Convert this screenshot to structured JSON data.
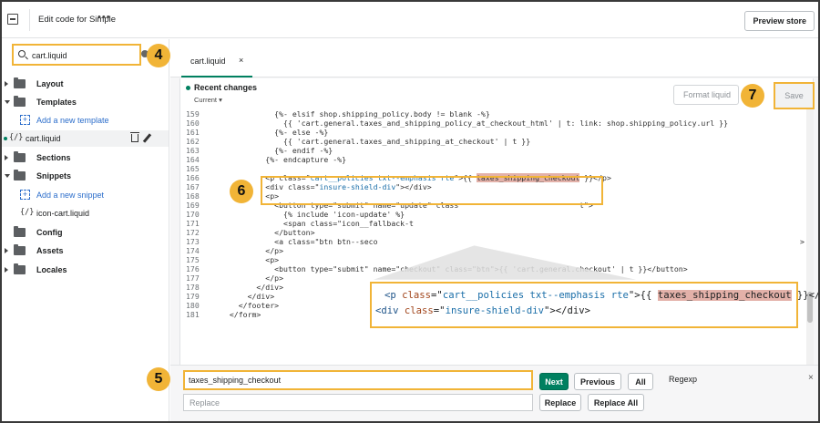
{
  "topbar": {
    "title": "Edit code for Simple",
    "more": "•••",
    "preview_label": "Preview store"
  },
  "sidebar": {
    "search_value": "cart.liquid",
    "items": [
      {
        "label": "Layout"
      },
      {
        "label": "Templates"
      },
      {
        "label": "Add a new template"
      },
      {
        "label": "cart.liquid"
      },
      {
        "label": "Sections"
      },
      {
        "label": "Snippets"
      },
      {
        "label": "Add a new snippet"
      },
      {
        "label": "icon-cart.liquid"
      },
      {
        "label": "Config"
      },
      {
        "label": "Assets"
      },
      {
        "label": "Locales"
      }
    ],
    "liquid_glyph": "{/}",
    "add_glyph": "+"
  },
  "badges": {
    "b4": "4",
    "b5": "5",
    "b6": "6",
    "b7": "7"
  },
  "editor": {
    "tab_label": "cart.liquid",
    "tab_close": "×",
    "recent_changes": "Recent changes",
    "current": "Current ▾",
    "format_label": "Format liquid",
    "save_label": "Save"
  },
  "code": {
    "lines": [
      {
        "n": "159",
        "t": "            {%- elsif shop.shipping_policy.body != blank -%}"
      },
      {
        "n": "160",
        "t": "              {{ 'cart.general.taxes_and_shipping_policy_at_checkout_html' | t: link: shop.shipping_policy.url }}"
      },
      {
        "n": "161",
        "t": "            {%- else -%}"
      },
      {
        "n": "162",
        "t": "              {{ 'cart.general.taxes_and_shipping_at_checkout' | t }}"
      },
      {
        "n": "163",
        "t": "            {%- endif -%}"
      },
      {
        "n": "164",
        "t": "          {%- endcapture -%}"
      },
      {
        "n": "165",
        "t": ""
      },
      {
        "n": "166",
        "t": ""
      },
      {
        "n": "167",
        "t": ""
      },
      {
        "n": "168",
        "t": "          <p>"
      },
      {
        "n": "169",
        "t": "            <button type=\"submit\" name=\"update\" class"
      },
      {
        "n": "170",
        "t": "              {% include 'icon-update' %}"
      },
      {
        "n": "171",
        "t": "              <span class=\"icon__fallback-t"
      },
      {
        "n": "172",
        "t": "            </button>"
      },
      {
        "n": "173",
        "t": "            <a class=\"btn btn--seco"
      },
      {
        "n": "174",
        "t": "          </p>"
      },
      {
        "n": "175",
        "t": "          <p>"
      },
      {
        "n": "176",
        "t": "            <button type=\"submit\" name=\"checkout\" class=\"btn\">{{ 'cart.general.checkout' | t }}</button>"
      },
      {
        "n": "177",
        "t": "          </p>"
      },
      {
        "n": "178",
        "t": "        </div>"
      },
      {
        "n": "179",
        "t": "      </div>"
      },
      {
        "n": "180",
        "t": "    </footer>"
      },
      {
        "n": "181",
        "t": "  </form>"
      }
    ],
    "line166": {
      "a": "          <p class=\"",
      "b": "cart__policies txt--emphasis rte",
      "c": "\">{{ ",
      "match": "taxes_shipping_checkout",
      "d": " }}</p>"
    },
    "line167": {
      "a": "          <div class=\"",
      "b": "insure-shield-div",
      "c": "\"></div>"
    },
    "tail169": "t\">",
    "tail173": ">"
  },
  "find": {
    "value": "taxes_shipping_checkout",
    "replace_placeholder": "Replace",
    "next": "Next",
    "previous": "Previous",
    "all": "All",
    "regexp": "Regexp",
    "replace": "Replace",
    "replace_all": "Replace All",
    "close": "×"
  },
  "colors": {
    "highlight_box": "#f1b437",
    "primary": "#008060",
    "match_bg": "#e3b1a9"
  }
}
